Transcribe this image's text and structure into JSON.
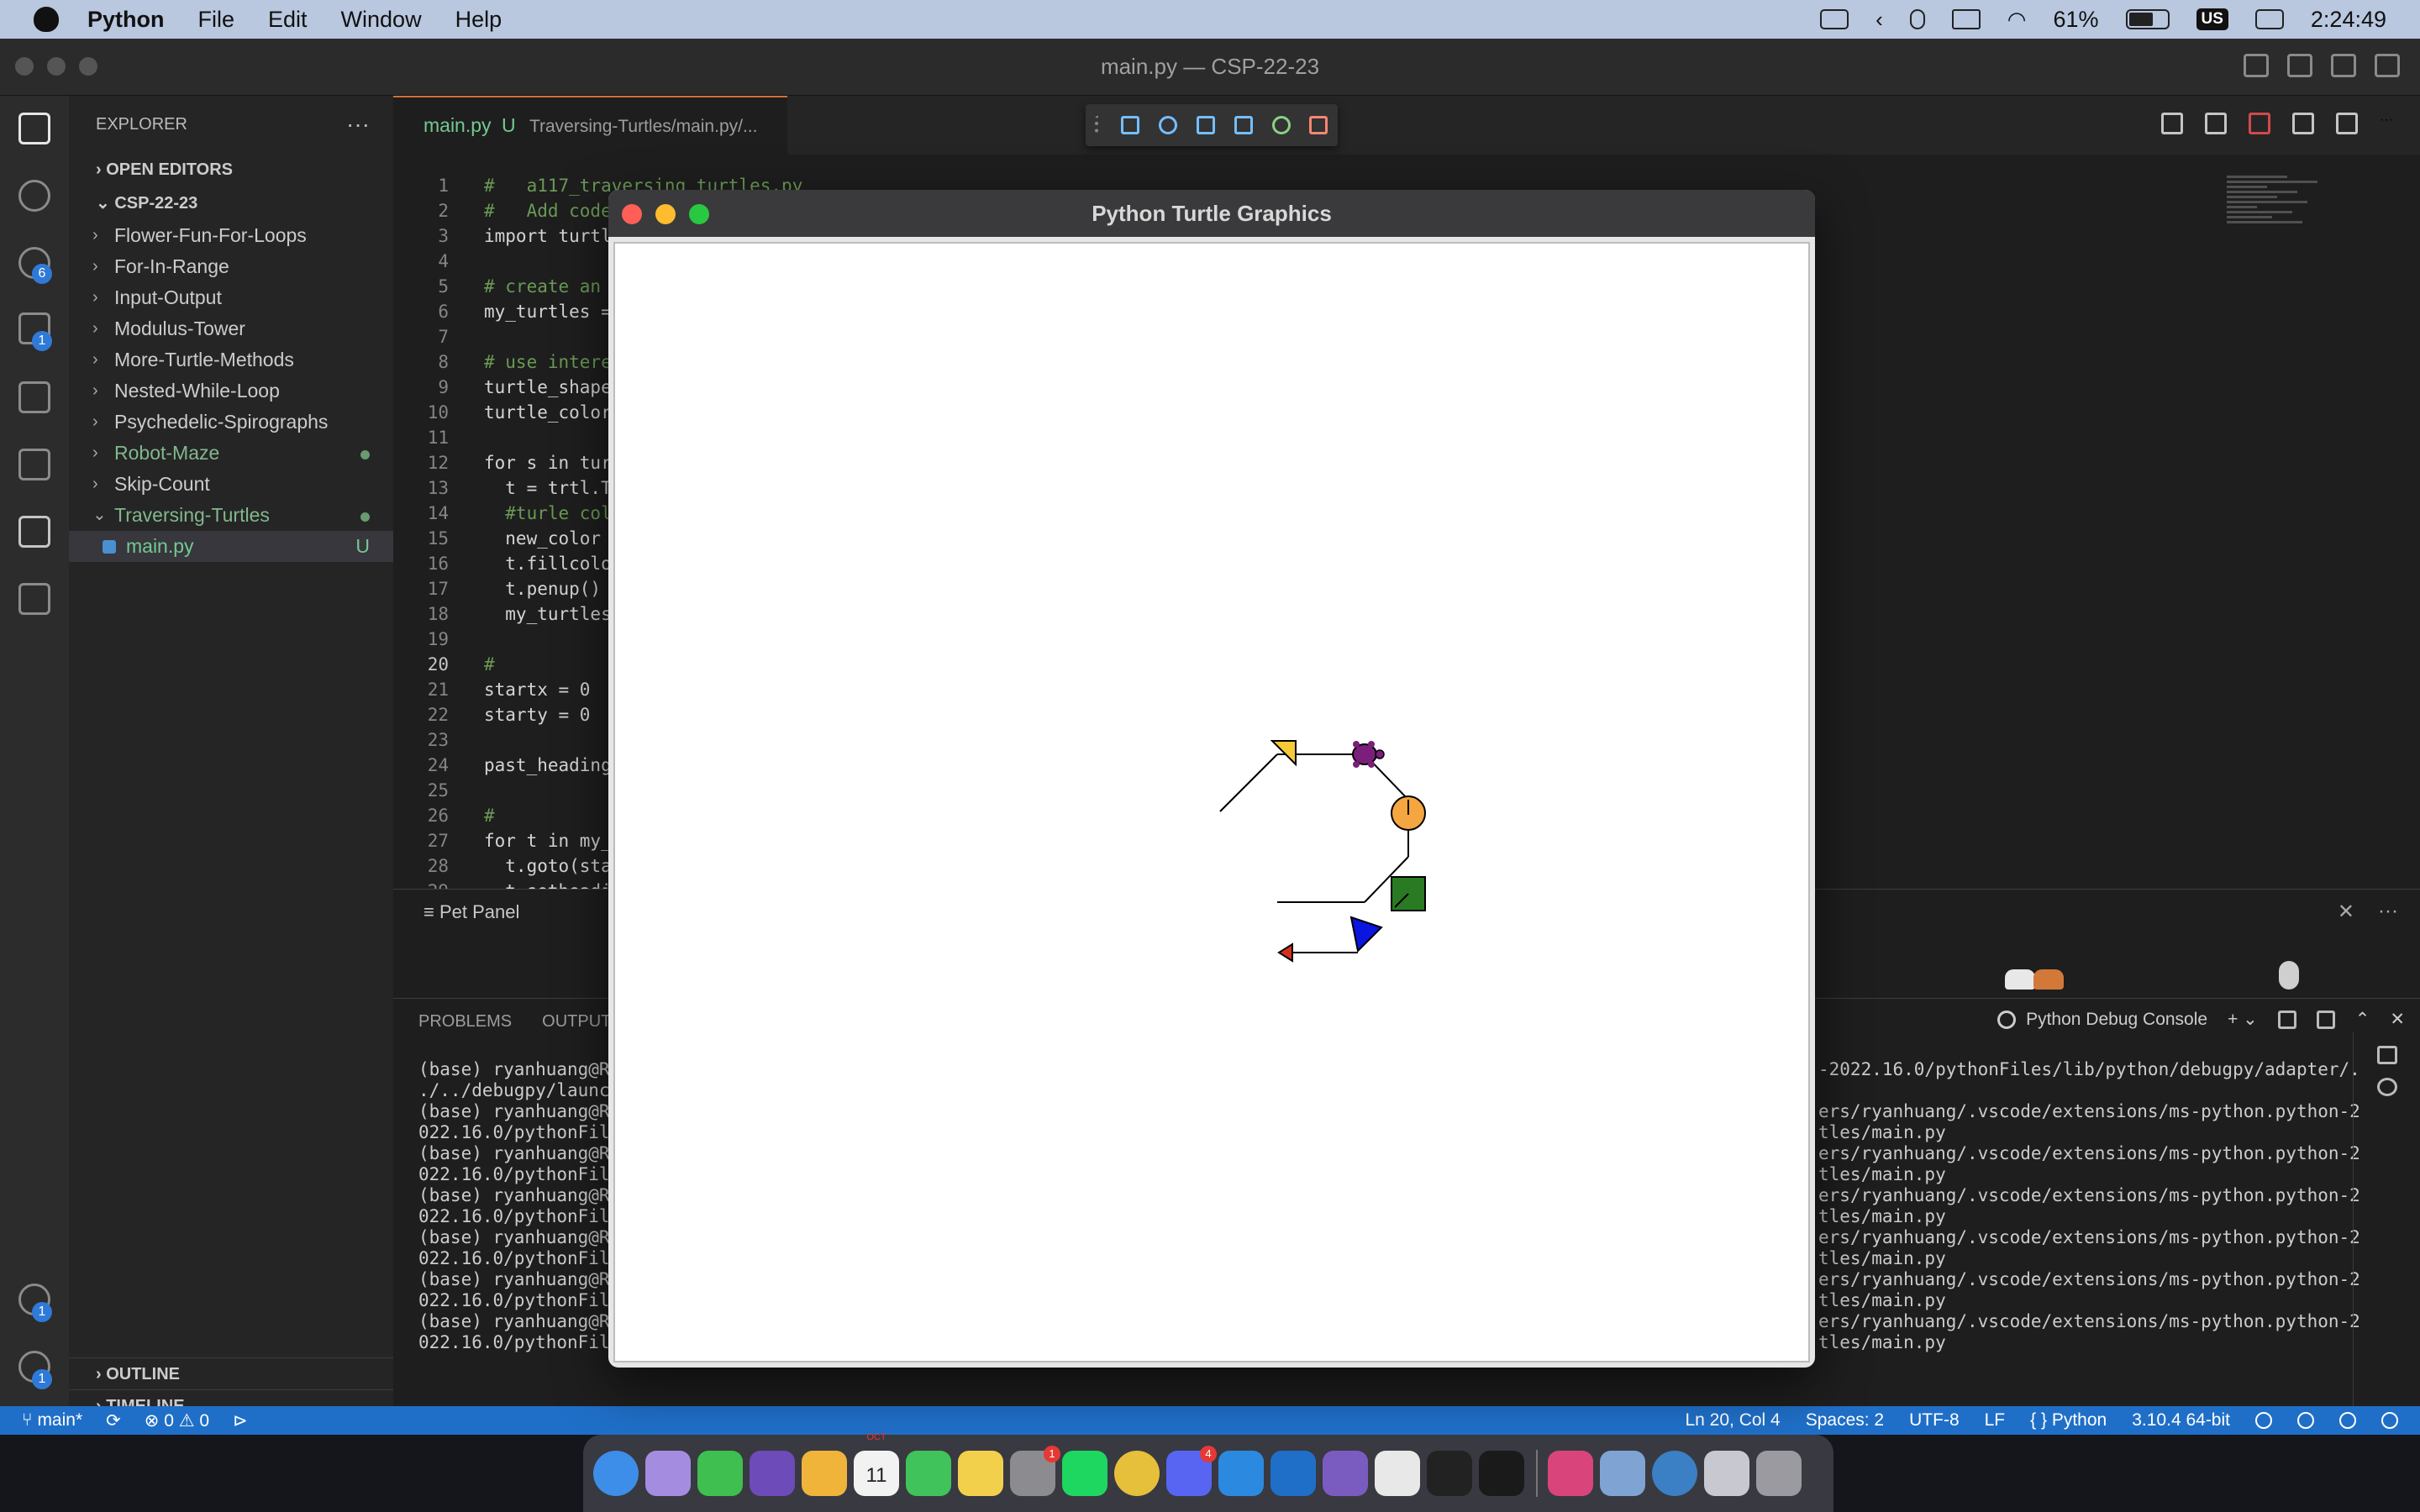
{
  "menubar": {
    "app_name": "Python",
    "menus": [
      "File",
      "Edit",
      "Window",
      "Help"
    ],
    "battery": "61%",
    "keyboard": "US",
    "clock": "2:24:49"
  },
  "window": {
    "title": "main.py — CSP-22-23"
  },
  "sidebar": {
    "header": "EXPLORER",
    "more": "···",
    "open_editors": "OPEN EDITORS",
    "project": "CSP-22-23",
    "folders": [
      {
        "label": "Flower-Fun-For-Loops"
      },
      {
        "label": "For-In-Range"
      },
      {
        "label": "Input-Output"
      },
      {
        "label": "Modulus-Tower"
      },
      {
        "label": "More-Turtle-Methods"
      },
      {
        "label": "Nested-While-Loop"
      },
      {
        "label": "Psychedelic-Spirographs"
      },
      {
        "label": "Robot-Maze"
      },
      {
        "label": "Skip-Count"
      },
      {
        "label": "Traversing-Turtles"
      }
    ],
    "open_file": {
      "label": "main.py",
      "status": "U"
    },
    "outline": "OUTLINE",
    "timeline": "TIMELINE"
  },
  "activity_badges": {
    "scm": "6",
    "debug": "1",
    "accounts": "1",
    "settings": "1"
  },
  "editor": {
    "tab_name": "main.py",
    "tab_status": "U",
    "tab_path": "Traversing-Turtles/main.py/...",
    "lines": [
      {
        "n": "1",
        "t": "#   a117_traversing_turtles.py",
        "cls": "cmt"
      },
      {
        "n": "2",
        "t": "#   Add code to make turtles move in a circle and change colors.",
        "cls": "cmt"
      },
      {
        "n": "3",
        "t": "import turtl",
        "cls": ""
      },
      {
        "n": "4",
        "t": "",
        "cls": ""
      },
      {
        "n": "5",
        "t": "# create an",
        "cls": "cmt"
      },
      {
        "n": "6",
        "t": "my_turtles =",
        "cls": ""
      },
      {
        "n": "7",
        "t": "",
        "cls": ""
      },
      {
        "n": "8",
        "t": "# use intere",
        "cls": "cmt"
      },
      {
        "n": "9",
        "t": "turtle_shape",
        "cls": ""
      },
      {
        "n": "10",
        "t": "turtle_color",
        "cls": ""
      },
      {
        "n": "11",
        "t": "",
        "cls": ""
      },
      {
        "n": "12",
        "t": "for s in tur",
        "cls": ""
      },
      {
        "n": "13",
        "t": "  t = trtl.T",
        "cls": ""
      },
      {
        "n": "14",
        "t": "  #turle col",
        "cls": "cmt"
      },
      {
        "n": "15",
        "t": "  new_color ",
        "cls": ""
      },
      {
        "n": "16",
        "t": "  t.fillcolo",
        "cls": ""
      },
      {
        "n": "17",
        "t": "  t.penup()",
        "cls": ""
      },
      {
        "n": "18",
        "t": "  my_turtles",
        "cls": ""
      },
      {
        "n": "19",
        "t": "",
        "cls": ""
      },
      {
        "n": "20",
        "t": "#",
        "cls": "cmt"
      },
      {
        "n": "21",
        "t": "startx = 0",
        "cls": ""
      },
      {
        "n": "22",
        "t": "starty = 0",
        "cls": ""
      },
      {
        "n": "23",
        "t": "",
        "cls": ""
      },
      {
        "n": "24",
        "t": "past_heading",
        "cls": ""
      },
      {
        "n": "25",
        "t": "",
        "cls": ""
      },
      {
        "n": "26",
        "t": "#",
        "cls": "cmt"
      },
      {
        "n": "27",
        "t": "for t in my_",
        "cls": ""
      },
      {
        "n": "28",
        "t": "  t.goto(sta",
        "cls": ""
      },
      {
        "n": "29",
        "t": "  t.setheadi",
        "cls": ""
      },
      {
        "n": "30",
        "t": "  t.pendown(",
        "cls": ""
      }
    ]
  },
  "pet_panel": {
    "title": "Pet Panel",
    "close": "✕",
    "more": "···"
  },
  "panel": {
    "tabs": [
      "PROBLEMS",
      "OUTPUT"
    ],
    "console_label": "Python Debug Console",
    "terminal_left": [
      "(base) ryanhuang@Ry",
      "./../debugpy/launch",
      "(base) ryanhuang@Ry",
      "022.16.0/pythonFil",
      "(base) ryanhuang@Ry",
      "022.16.0/pythonFil",
      "(base) ryanhuang@Ry",
      "022.16.0/pythonFil",
      "(base) ryanhuang@Ry",
      "022.16.0/pythonFil",
      "(base) ryanhuang@Ry",
      "022.16.0/pythonFil",
      "(base) ryanhuang@Ry",
      "022.16.0/pythonFil"
    ],
    "terminal_right": [
      "-2022.16.0/pythonFiles/lib/python/debugpy/adapter/.",
      "",
      "ers/ryanhuang/.vscode/extensions/ms-python.python-2",
      "tles/main.py",
      "ers/ryanhuang/.vscode/extensions/ms-python.python-2",
      "tles/main.py",
      "ers/ryanhuang/.vscode/extensions/ms-python.python-2",
      "tles/main.py",
      "ers/ryanhuang/.vscode/extensions/ms-python.python-2",
      "tles/main.py",
      "ers/ryanhuang/.vscode/extensions/ms-python.python-2",
      "tles/main.py",
      "ers/ryanhuang/.vscode/extensions/ms-python.python-2",
      "tles/main.py"
    ]
  },
  "statusbar": {
    "branch": "main*",
    "errors": "0",
    "warnings": "0",
    "position": "Ln 20, Col 4",
    "spaces": "Spaces: 2",
    "encoding": "UTF-8",
    "eol": "LF",
    "language": "Python",
    "interpreter": "3.10.4 64-bit"
  },
  "turtle_window": {
    "title": "Python Turtle Graphics"
  },
  "dock": {
    "apps": [
      {
        "name": "finder",
        "color": "#3d8ee8"
      },
      {
        "name": "launchpad",
        "color": "#a48de0"
      },
      {
        "name": "facetime",
        "color": "#3fbf4f"
      },
      {
        "name": "safari-tech",
        "color": "#6d4bb8"
      },
      {
        "name": "photos",
        "color": "#f0b43a"
      },
      {
        "name": "calendar",
        "color": "#f2f2f2"
      },
      {
        "name": "messages",
        "color": "#40c35a"
      },
      {
        "name": "notes",
        "color": "#f3d04c"
      },
      {
        "name": "system-settings",
        "color": "#8c8c90"
      },
      {
        "name": "spotify",
        "color": "#1ed760"
      },
      {
        "name": "chrome",
        "color": "#e6c03a"
      },
      {
        "name": "discord",
        "color": "#5865f2"
      },
      {
        "name": "vscode",
        "color": "#2b8ae0"
      },
      {
        "name": "vscode-2",
        "color": "#1f6fc8"
      },
      {
        "name": "github",
        "color": "#7a5cc0"
      },
      {
        "name": "slack",
        "color": "#e8e8e8"
      },
      {
        "name": "terminal",
        "color": "#222222"
      },
      {
        "name": "activity-monitor",
        "color": "#1a1a1a"
      },
      {
        "name": "instagram",
        "color": "#d9457b"
      },
      {
        "name": "preview",
        "color": "#7fa4d4"
      },
      {
        "name": "quicktime",
        "color": "#3b7fc4"
      },
      {
        "name": "rocket",
        "color": "#c8c8d0"
      },
      {
        "name": "trash",
        "color": "#9a9aa0"
      }
    ],
    "calendar_day": "11",
    "calendar_month": "OCT",
    "settings_badge": "1",
    "discord_badge": "4"
  }
}
